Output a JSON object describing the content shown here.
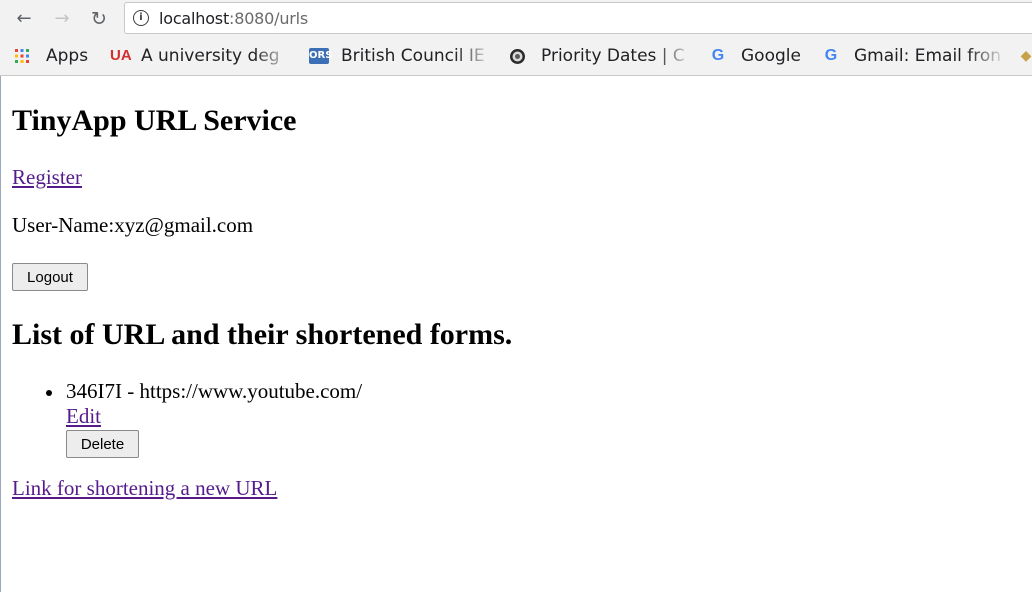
{
  "browser": {
    "url_host": "localhost",
    "url_rest": ":8080/urls",
    "bookmarks": [
      {
        "label": "Apps",
        "icon": "apps-grid-icon"
      },
      {
        "label": "A university deg",
        "icon": "ua-icon"
      },
      {
        "label": "British Council IE",
        "icon": "ors-icon"
      },
      {
        "label": "Priority Dates | C",
        "icon": "seal-icon"
      },
      {
        "label": "Google",
        "icon": "google-icon"
      },
      {
        "label": "Gmail: Email fron",
        "icon": "google-icon"
      }
    ]
  },
  "page": {
    "title": "TinyApp URL Service",
    "register_label": "Register",
    "user_line": "User-Name:xyz@gmail.com",
    "logout_label": "Logout",
    "list_heading": "List of URL and their shortened forms.",
    "urls": [
      {
        "text": "346I7I - https://www.youtube.com/",
        "edit_label": "Edit",
        "delete_label": "Delete"
      }
    ],
    "new_link_label": "Link for shortening a new URL"
  },
  "colors": {
    "link_visited": "#551a8b",
    "chrome_bg": "#f2f2f2"
  }
}
